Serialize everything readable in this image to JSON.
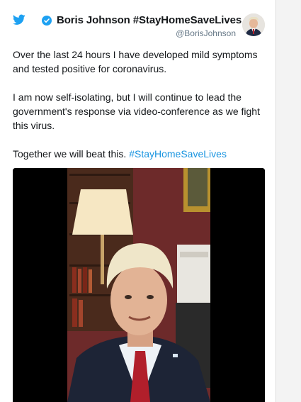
{
  "tweet": {
    "display_name": "Boris Johnson #StayHomeSaveLives",
    "handle": "@BorisJohnson",
    "paragraph_1": "Over the last 24 hours I have developed mild symptoms and tested positive for coronavirus.",
    "paragraph_2": "I am now self-isolating, but I will continue to lead the government's response via video-conference as we fight this virus.",
    "paragraph_3_text": "Together we will beat this. ",
    "paragraph_3_hashtag": "#StayHomeSaveLives"
  },
  "icons": {
    "brand": "twitter-bird-icon",
    "verified": "verified-badge-icon"
  },
  "colors": {
    "twitter_blue": "#1da1f2",
    "link_blue": "#1b95e0",
    "text": "#14171a",
    "muted": "#657786"
  }
}
